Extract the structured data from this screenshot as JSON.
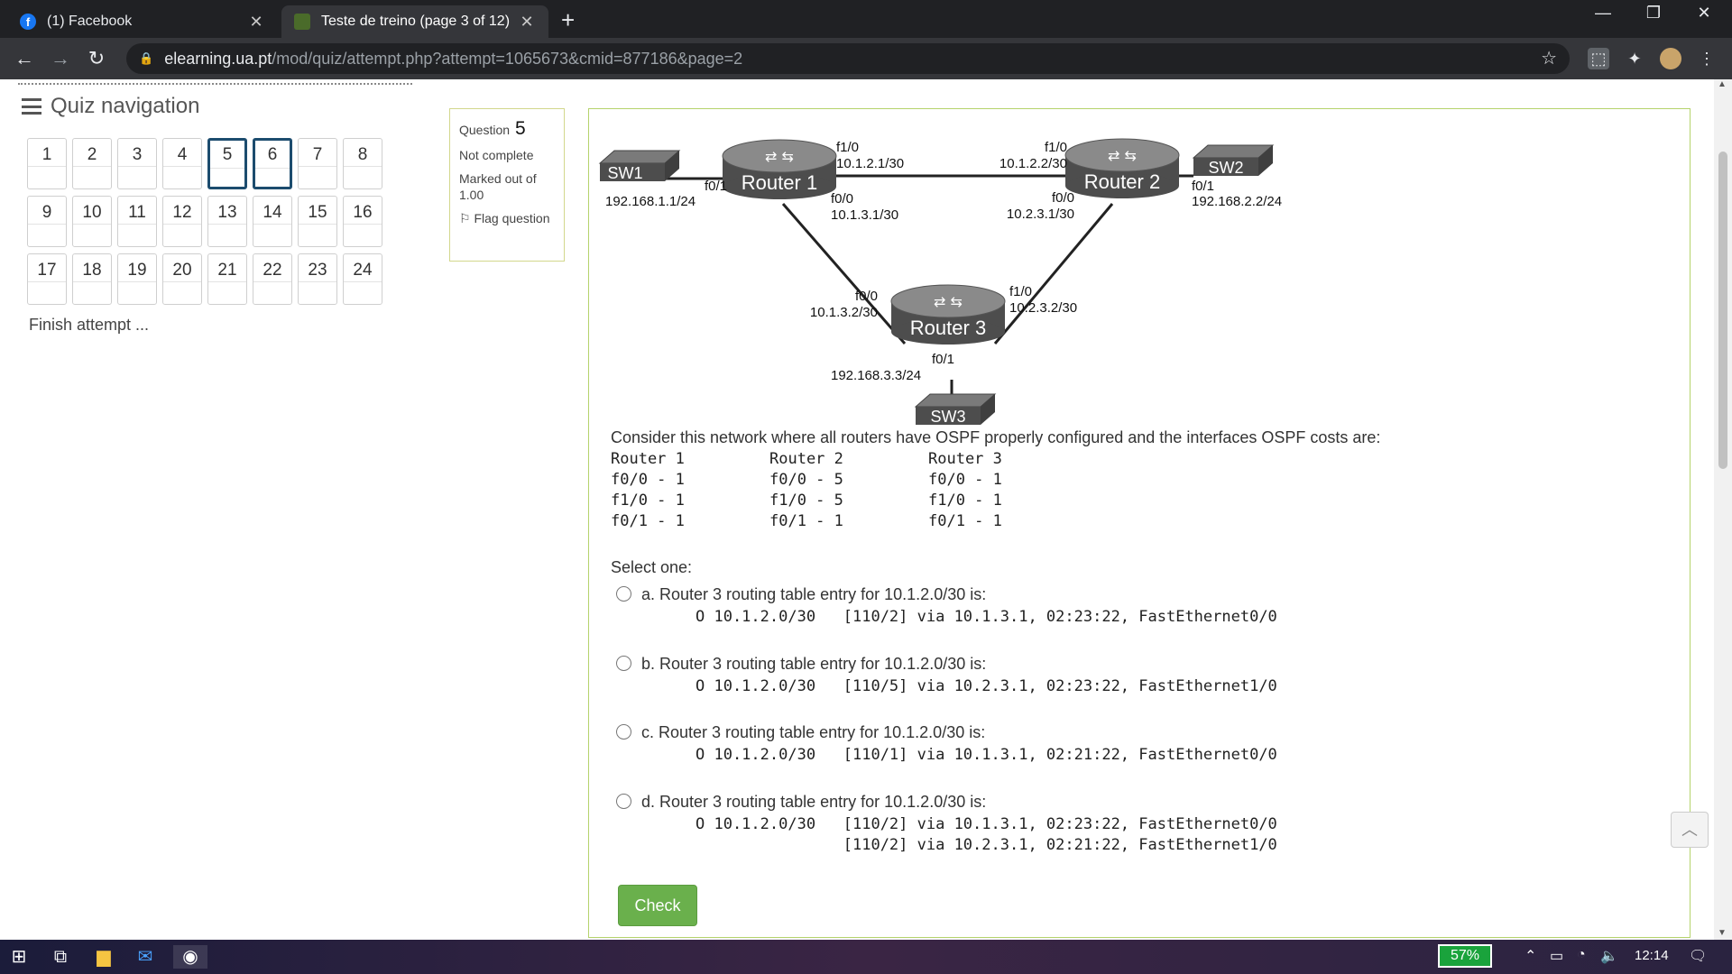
{
  "browser": {
    "tabs": [
      {
        "title": "(1) Facebook",
        "icon": "facebook-icon",
        "active": false
      },
      {
        "title": "Teste de treino (page 3 of 12)",
        "icon": "moodle-icon",
        "active": true
      }
    ],
    "url_host": "elearning.ua.pt",
    "url_path": "/mod/quiz/attempt.php?attempt=1065673&cmid=877186&page=2"
  },
  "quiz_nav": {
    "title": "Quiz navigation",
    "questions": [
      "1",
      "2",
      "3",
      "4",
      "5",
      "6",
      "7",
      "8",
      "9",
      "10",
      "11",
      "12",
      "13",
      "14",
      "15",
      "16",
      "17",
      "18",
      "19",
      "20",
      "21",
      "22",
      "23",
      "24"
    ],
    "current": [
      "5",
      "6"
    ],
    "finish": "Finish attempt ..."
  },
  "question": {
    "label": "Question",
    "number": "5",
    "status": "Not complete",
    "marked": "Marked out of 1.00",
    "flag": "Flag question"
  },
  "diagram": {
    "devices": {
      "r1": "Router 1",
      "r2": "Router 2",
      "r3": "Router 3",
      "sw1": "SW1",
      "sw2": "SW2",
      "sw3": "SW3"
    },
    "labels": {
      "r1_f1_0": "f1/0",
      "r1_f1_0_ip": "10.1.2.1/30",
      "r2_f1_0": "f1/0",
      "r2_f1_0_ip": "10.1.2.2/30",
      "r1_f0_1": "f0/1",
      "r1_f0_1_ip": "192.168.1.1/24",
      "r2_f0_1": "f0/1",
      "r2_f0_1_ip": "192.168.2.2/24",
      "r1_f0_0": "f0/0",
      "r1_f0_0_ip": "10.1.3.1/30",
      "r2_f0_0": "f0/0",
      "r2_f0_0_ip": "10.2.3.1/30",
      "r3_f0_0": "f0/0",
      "r3_f0_0_ip": "10.1.3.2/30",
      "r3_f1_0": "f1/0",
      "r3_f1_0_ip": "10.2.3.2/30",
      "r3_f0_1": "f0/1",
      "r3_f0_1_ip": "192.168.3.3/24"
    }
  },
  "body": {
    "intro": "Consider this network where all routers have OSPF properly configured and the interfaces OSPF costs are:",
    "costs": [
      [
        "Router 1",
        "Router 2",
        "Router 3"
      ],
      [
        "f0/0 - 1",
        "f0/0 - 5",
        "f0/0 - 1"
      ],
      [
        "f1/0 - 1",
        "f1/0 - 5",
        "f1/0 - 1"
      ],
      [
        "f0/1 - 1",
        "f0/1 - 1",
        "f0/1 - 1"
      ]
    ],
    "select_one": "Select one:",
    "options": [
      {
        "label": "a. Router 3 routing table entry for 10.1.2.0/30 is:",
        "route": "O 10.1.2.0/30   [110/2] via 10.1.3.1, 02:23:22, FastEthernet0/0"
      },
      {
        "label": "b. Router 3 routing table entry for 10.1.2.0/30 is:",
        "route": "O 10.1.2.0/30   [110/5] via 10.2.3.1, 02:23:22, FastEthernet1/0"
      },
      {
        "label": "c. Router 3 routing table entry for 10.1.2.0/30 is:",
        "route": "O 10.1.2.0/30   [110/1] via 10.1.3.1, 02:21:22, FastEthernet0/0"
      },
      {
        "label": "d. Router 3 routing table entry for 10.1.2.0/30 is:",
        "route": "O 10.1.2.0/30   [110/2] via 10.1.3.1, 02:23:22, FastEthernet0/0\n                [110/2] via 10.2.3.1, 02:21:22, FastEthernet1/0"
      }
    ],
    "check": "Check"
  },
  "taskbar": {
    "battery": "57%",
    "time": "12:14"
  },
  "colors": {
    "accent_green": "#6ab04c",
    "current_question_border": "#1c4c6e",
    "chrome_dark": "#202124"
  }
}
